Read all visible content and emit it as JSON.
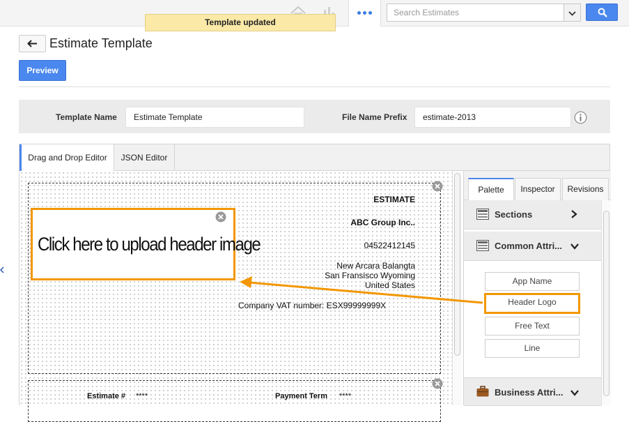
{
  "toast": {
    "message": "Template updated"
  },
  "header": {
    "search_placeholder": "Search Estimates"
  },
  "page": {
    "title": "Estimate Template",
    "preview_label": "Preview"
  },
  "form": {
    "template_name_label": "Template Name",
    "template_name_value": "Estimate Template",
    "file_prefix_label": "File Name Prefix",
    "file_prefix_value": "estimate-2013"
  },
  "editor_tabs": [
    {
      "label": "Drag and Drop Editor",
      "active": true
    },
    {
      "label": "JSON Editor",
      "active": false
    }
  ],
  "canvas": {
    "heading": "ESTIMATE",
    "company": "ABC Group Inc..",
    "phone": "04522412145",
    "address_line1": "New Arcara Balangta",
    "address_line2": "San Fransisco  Wyoming",
    "address_line3": "United States",
    "vat": "Company VAT number: ESX99999999X",
    "upload_prompt": "Click here to upload header image",
    "estimate_no_label": "Estimate #",
    "estimate_no_value": "****",
    "payment_term_label": "Payment Term",
    "payment_term_value": "****"
  },
  "palette": {
    "tabs": [
      {
        "label": "Palette",
        "active": true
      },
      {
        "label": "Inspector",
        "active": false
      },
      {
        "label": "Revisions",
        "active": false
      }
    ],
    "sections_label": "Sections",
    "common_label": "Common Attri...",
    "common_items": [
      "App Name",
      "Header Logo",
      "Free Text",
      "Line"
    ],
    "business_label": "Business Attri..."
  },
  "colors": {
    "accent_blue": "#4a87ee",
    "highlight_orange": "#f39700",
    "toast_bg": "#fbe9a8"
  }
}
